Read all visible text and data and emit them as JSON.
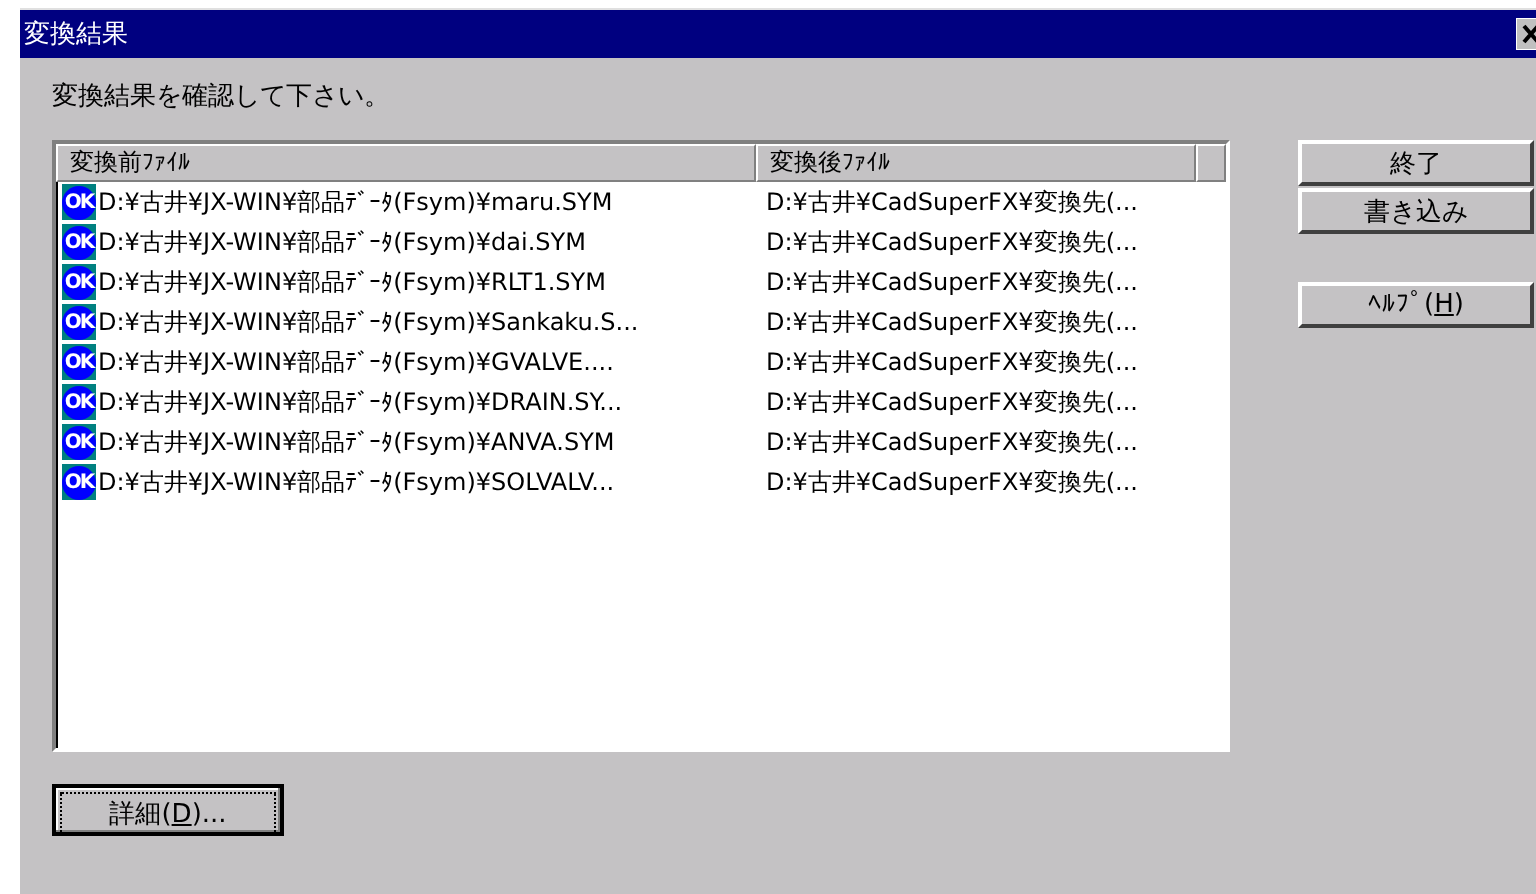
{
  "window": {
    "title": "変換結果"
  },
  "message": "変換結果を確認して下さい。",
  "table": {
    "columns": [
      "変換前ﾌｧｲﾙ",
      "変換後ﾌｧｲﾙ"
    ],
    "rows": [
      {
        "status": "OK",
        "source": "D:¥古井¥JX-WIN¥部品ﾃﾞｰﾀ(Fsym)¥maru.SYM",
        "target": "D:¥古井¥CadSuperFX¥変換先(..."
      },
      {
        "status": "OK",
        "source": "D:¥古井¥JX-WIN¥部品ﾃﾞｰﾀ(Fsym)¥dai.SYM",
        "target": "D:¥古井¥CadSuperFX¥変換先(..."
      },
      {
        "status": "OK",
        "source": "D:¥古井¥JX-WIN¥部品ﾃﾞｰﾀ(Fsym)¥RLT1.SYM",
        "target": "D:¥古井¥CadSuperFX¥変換先(..."
      },
      {
        "status": "OK",
        "source": "D:¥古井¥JX-WIN¥部品ﾃﾞｰﾀ(Fsym)¥Sankaku.S...",
        "target": "D:¥古井¥CadSuperFX¥変換先(..."
      },
      {
        "status": "OK",
        "source": "D:¥古井¥JX-WIN¥部品ﾃﾞｰﾀ(Fsym)¥GVALVE....",
        "target": "D:¥古井¥CadSuperFX¥変換先(..."
      },
      {
        "status": "OK",
        "source": "D:¥古井¥JX-WIN¥部品ﾃﾞｰﾀ(Fsym)¥DRAIN.SY...",
        "target": "D:¥古井¥CadSuperFX¥変換先(..."
      },
      {
        "status": "OK",
        "source": "D:¥古井¥JX-WIN¥部品ﾃﾞｰﾀ(Fsym)¥ANVA.SYM",
        "target": "D:¥古井¥CadSuperFX¥変換先(..."
      },
      {
        "status": "OK",
        "source": "D:¥古井¥JX-WIN¥部品ﾃﾞｰﾀ(Fsym)¥SOLVALV...",
        "target": "D:¥古井¥CadSuperFX¥変換先(..."
      }
    ]
  },
  "buttons": [
    {
      "before": "終了"
    },
    {
      "before": "書き込み"
    },
    {
      "before": "ﾍﾙﾌﾟ(",
      "mnemonic": "H",
      "after": ")"
    }
  ],
  "details_button": {
    "before": "詳細(",
    "mnemonic": "D",
    "after": ")..."
  }
}
